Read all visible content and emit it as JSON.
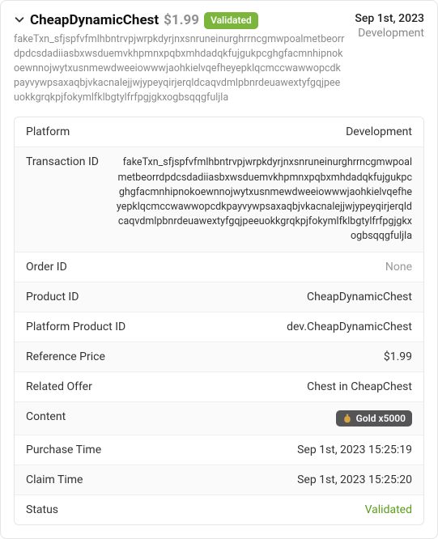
{
  "header": {
    "title": "CheapDynamicChest",
    "price": "$1.99",
    "badge": "Validated",
    "date": "Sep 1st, 2023",
    "env": "Development"
  },
  "sub_hash": "fakeTxn_sfjspfvfmlhbntrvpjwrpkdyrjnxsnruneinurghrrncgmwpoalmetbeorrdpdcsdadiiasbxwsduemvkhpmnxpqbxmhdadqkfujgukpcghgfacmnhipnokoewnnojwytxusnmewdweeiowwwjaohkielvqefheyepklqcmccwawwopcdkpayvywpsaxaqbjvkacnalejjwjypeyqirjerqldcaqvdmlpbnrdeuawextyfgqjpeeuokkgrqkpjfokymlfklbgtylfrfpgjgkxogbsqqgfuljla",
  "rows": {
    "platform": {
      "label": "Platform",
      "value": "Development"
    },
    "txn_id": {
      "label": "Transaction ID",
      "value": "fakeTxn_sfjspfvfmlhbntrvpjwrpkdyrjnxsnruneinurghrrncgmwpoalmetbeorrdpdcsdadiiasbxwsduemvkhpmnxpqbxmhdadqkfujgukpcghgfacmnhipnokoewnnojwytxusnmewdweeiowwwjaohkielvqefheyepklqcmccwawwopcdkpayvywpsaxaqbjvkacnalejjwjypeyqirjerqldcaqvdmlpbnrdeuawextyfgqjpeeuokkgrqkpjfokymlfklbgtylfrfpgjgkxogbsqqgfuljla"
    },
    "order_id": {
      "label": "Order ID",
      "value": "None"
    },
    "product_id": {
      "label": "Product ID",
      "value": "CheapDynamicChest"
    },
    "platform_product_id": {
      "label": "Platform Product ID",
      "value": "dev.CheapDynamicChest"
    },
    "reference_price": {
      "label": "Reference Price",
      "value": "$1.99"
    },
    "related_offer": {
      "label": "Related Offer",
      "value": "Chest in CheapChest"
    },
    "content": {
      "label": "Content",
      "value": "Gold x5000"
    },
    "purchase_time": {
      "label": "Purchase Time",
      "value": "Sep 1st, 2023 15:25:19"
    },
    "claim_time": {
      "label": "Claim Time",
      "value": "Sep 1st, 2023 15:25:20"
    },
    "status": {
      "label": "Status",
      "value": "Validated"
    }
  }
}
